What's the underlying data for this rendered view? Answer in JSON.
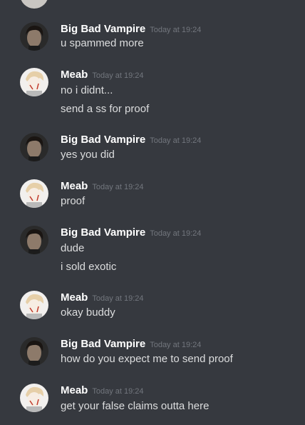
{
  "messages": [
    {
      "author": "Big Bad Vampire",
      "avatar": "vampire-avatar",
      "timestamp": "Today at 19:24",
      "lines": [
        "u spammed more"
      ]
    },
    {
      "author": "Meab",
      "avatar": "meab-avatar",
      "timestamp": "Today at 19:24",
      "lines": [
        "no i didnt...",
        "send a ss for proof"
      ]
    },
    {
      "author": "Big Bad Vampire",
      "avatar": "vampire-avatar",
      "timestamp": "Today at 19:24",
      "lines": [
        "yes you did"
      ]
    },
    {
      "author": "Meab",
      "avatar": "meab-avatar",
      "timestamp": "Today at 19:24",
      "lines": [
        "proof"
      ]
    },
    {
      "author": "Big Bad Vampire",
      "avatar": "vampire-avatar",
      "timestamp": "Today at 19:24",
      "lines": [
        "dude",
        "i sold exotic"
      ]
    },
    {
      "author": "Meab",
      "avatar": "meab-avatar",
      "timestamp": "Today at 19:24",
      "lines": [
        "okay buddy"
      ]
    },
    {
      "author": "Big Bad Vampire",
      "avatar": "vampire-avatar",
      "timestamp": "Today at 19:24",
      "lines": [
        "how do you expect me to send proof"
      ]
    },
    {
      "author": "Meab",
      "avatar": "meab-avatar",
      "timestamp": "Today at 19:24",
      "lines": [
        "get your false claims outta here"
      ]
    }
  ],
  "colors": {
    "background": "#36393f",
    "username": "#ffffff",
    "timestamp": "#72767d",
    "message_text": "#dcddde"
  }
}
